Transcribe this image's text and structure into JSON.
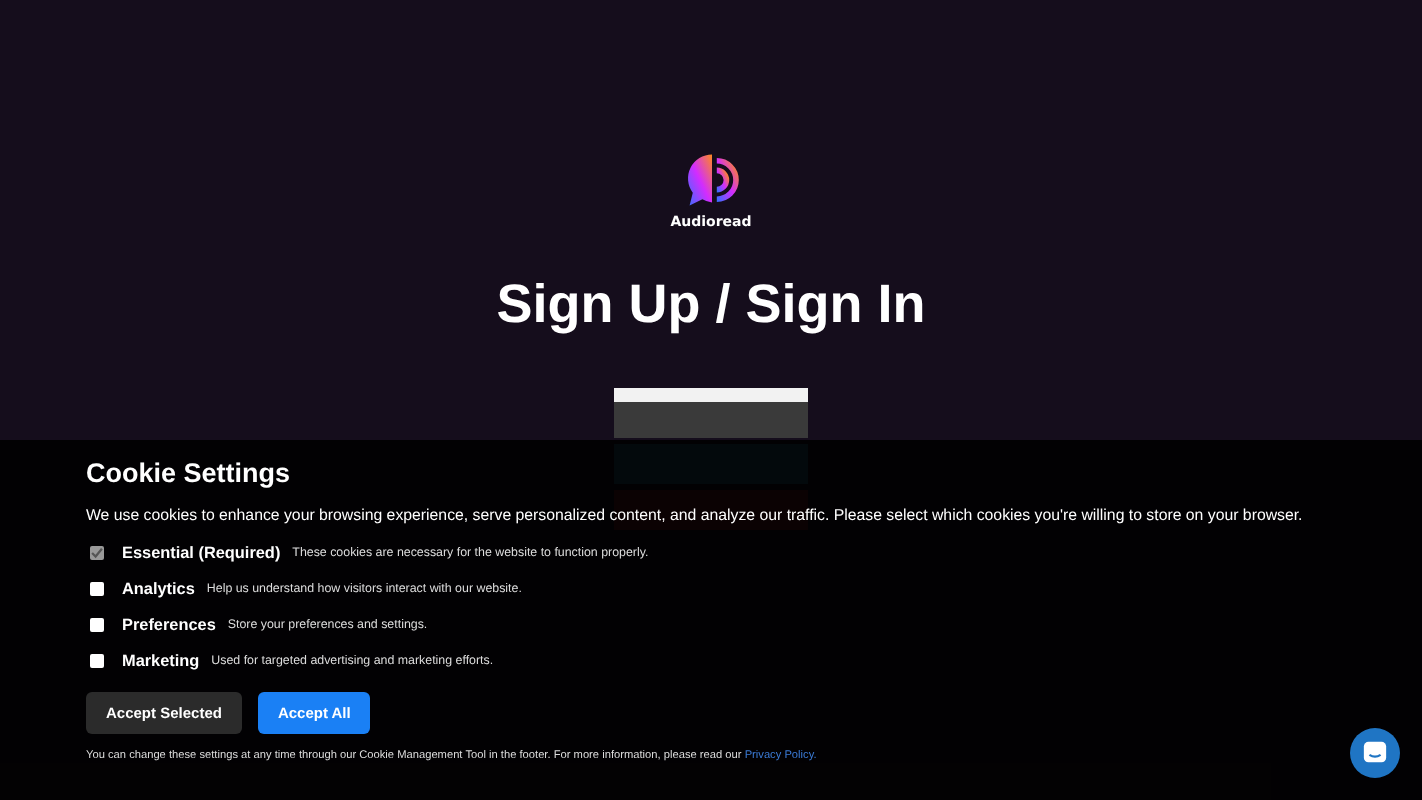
{
  "logo": {
    "name": "Audioread"
  },
  "heading": "Sign Up / Sign In",
  "cookie_banner": {
    "title": "Cookie Settings",
    "intro": "We use cookies to enhance your browsing experience, serve personalized content, and analyze our traffic. Please select which cookies you're willing to store on your browser.",
    "options": [
      {
        "label": "Essential (Required)",
        "description": "These cookies are necessary for the website to function properly.",
        "checked": true,
        "disabled": true
      },
      {
        "label": "Analytics",
        "description": "Help us understand how visitors interact with our website.",
        "checked": false,
        "disabled": false
      },
      {
        "label": "Preferences",
        "description": "Store your preferences and settings.",
        "checked": false,
        "disabled": false
      },
      {
        "label": "Marketing",
        "description": "Used for targeted advertising and marketing efforts.",
        "checked": false,
        "disabled": false
      }
    ],
    "buttons": [
      {
        "label": "Accept Selected",
        "kind": "secondary"
      },
      {
        "label": "Accept All",
        "kind": "primary"
      }
    ],
    "footnote": "You can change these settings at any time through our Cookie Management Tool in the footer. For more information, please read our",
    "link": "Privacy Policy."
  }
}
